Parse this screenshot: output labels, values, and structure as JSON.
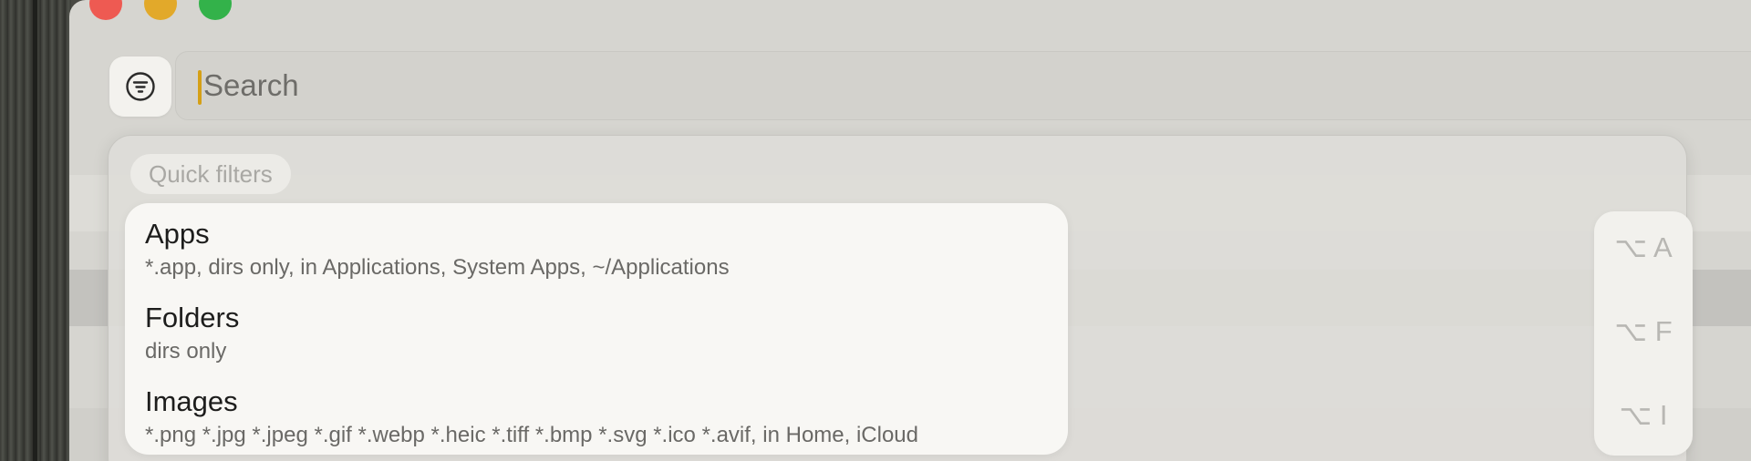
{
  "window": {
    "traffic_lights": [
      "close",
      "minimize",
      "zoom"
    ]
  },
  "toolbar": {
    "filter_icon": "filter-lines-icon",
    "search": {
      "placeholder": "Search",
      "value": ""
    }
  },
  "quick_filters": {
    "title": "Quick filters",
    "items": [
      {
        "name": "Apps",
        "description": "*.app, dirs only, in Applications, System Apps, ~/Applications",
        "shortcut": "⌥ A"
      },
      {
        "name": "Folders",
        "description": "dirs only",
        "shortcut": "⌥ F"
      },
      {
        "name": "Images",
        "description": "*.png *.jpg *.jpeg *.gif *.webp *.heic *.tiff *.bmp *.svg *.ico *.avif, in Home, iCloud",
        "shortcut": "⌥ I"
      }
    ]
  },
  "colors": {
    "close": "#ee5a52",
    "minimize": "#e2a92a",
    "zoom": "#33b24a",
    "caret": "#d5a016"
  }
}
